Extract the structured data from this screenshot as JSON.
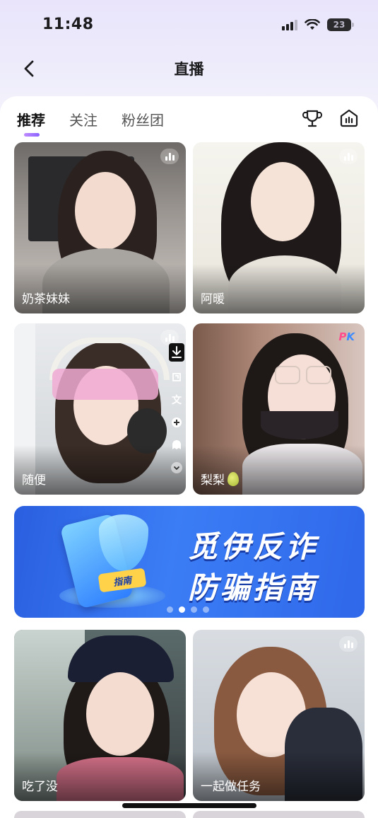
{
  "status_bar": {
    "time": "11:48",
    "battery": "23"
  },
  "nav": {
    "title": "直播"
  },
  "tabs": [
    {
      "label": "推荐",
      "active": true
    },
    {
      "label": "关注",
      "active": false
    },
    {
      "label": "粉丝团",
      "active": false
    }
  ],
  "header_icons": [
    "trophy-icon",
    "live-room-icon"
  ],
  "streams_top": [
    {
      "name": "奶茶妹妹",
      "badge": "live-bars-icon"
    },
    {
      "name": "阿暖",
      "badge": "live-bars-icon"
    },
    {
      "name": "随便",
      "badge": "live-bars-icon"
    },
    {
      "name": "梨梨",
      "badge": "PK"
    }
  ],
  "side_tools": [
    "download-icon",
    "share-icon",
    "文",
    "add-icon",
    "ghost-icon",
    "chevron-down-icon"
  ],
  "banner": {
    "line1": "觅伊反诈",
    "line2": "防骗指南",
    "tag": "指南",
    "page_count": 4,
    "active_index": 1
  },
  "streams_bottom": [
    {
      "name": "吃了没",
      "badge": ""
    },
    {
      "name": "一起做任务",
      "badge": "live-bars-icon"
    }
  ],
  "colors": {
    "tab_indicator": "#8a63ff",
    "banner_blue": "#2f68ea",
    "pk_pink": "#ff4d8d",
    "pk_blue": "#3d8bff"
  }
}
